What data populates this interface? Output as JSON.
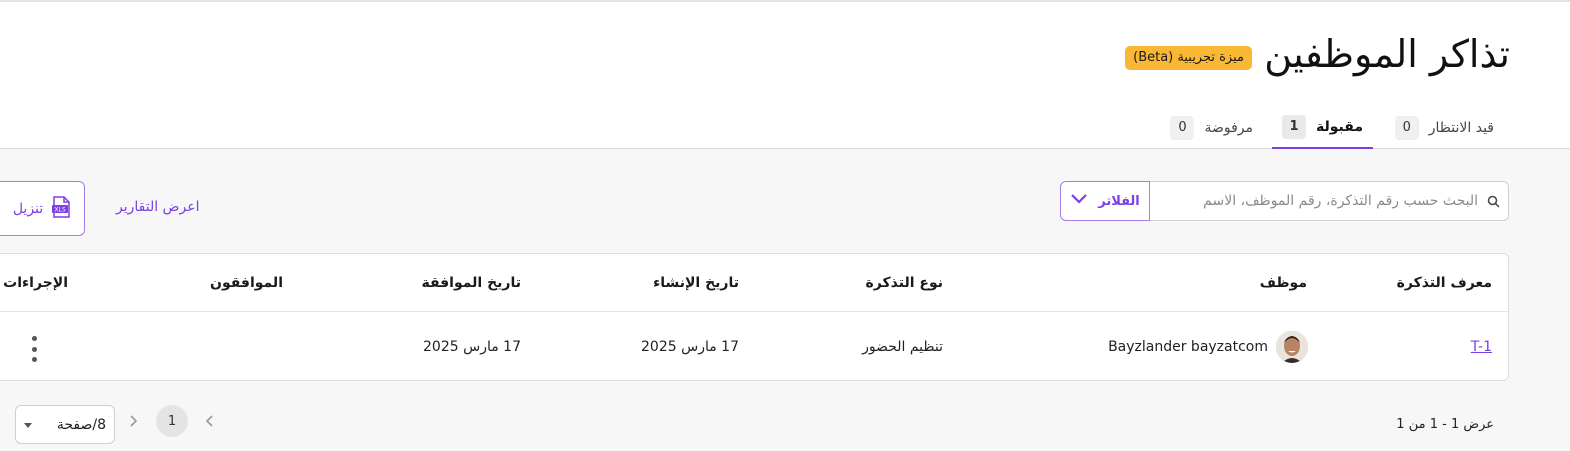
{
  "header": {
    "title": "تذاكر الموظفين",
    "beta_badge": "ميزة تجريبية (Beta)"
  },
  "tabs": [
    {
      "label": "قيد الانتظار",
      "count": "0",
      "active": false
    },
    {
      "label": "مقبولة",
      "count": "1",
      "active": true
    },
    {
      "label": "مرفوضة",
      "count": "0",
      "active": false
    }
  ],
  "toolbar": {
    "search_placeholder": "البحث حسب رقم التذكرة، رقم الموظف، الاسم",
    "filters_label": "الفلاتر",
    "reports_label": "اعرض التقارير",
    "download_label": "تنزيل",
    "download_badge": "XLS"
  },
  "table": {
    "columns": [
      "معرف التذكرة",
      "موظف",
      "نوع التذكرة",
      "تاريخ الإنشاء",
      "تاريخ الموافقة",
      "الموافقون",
      "الإجراءات"
    ],
    "rows": [
      {
        "ticket_id": "T-1",
        "employee": "Bayzlander bayzatcom",
        "ticket_type": "تنظيم الحضور",
        "created": "17 مارس 2025",
        "approved": "17 مارس 2025",
        "approvers": ""
      }
    ]
  },
  "pagination": {
    "info": "عرض 1 - 1 من 1",
    "current_page": "1",
    "per_page": "8/صفحة"
  },
  "colors": {
    "accent": "#7b3fe4",
    "beta": "#f9b834"
  }
}
